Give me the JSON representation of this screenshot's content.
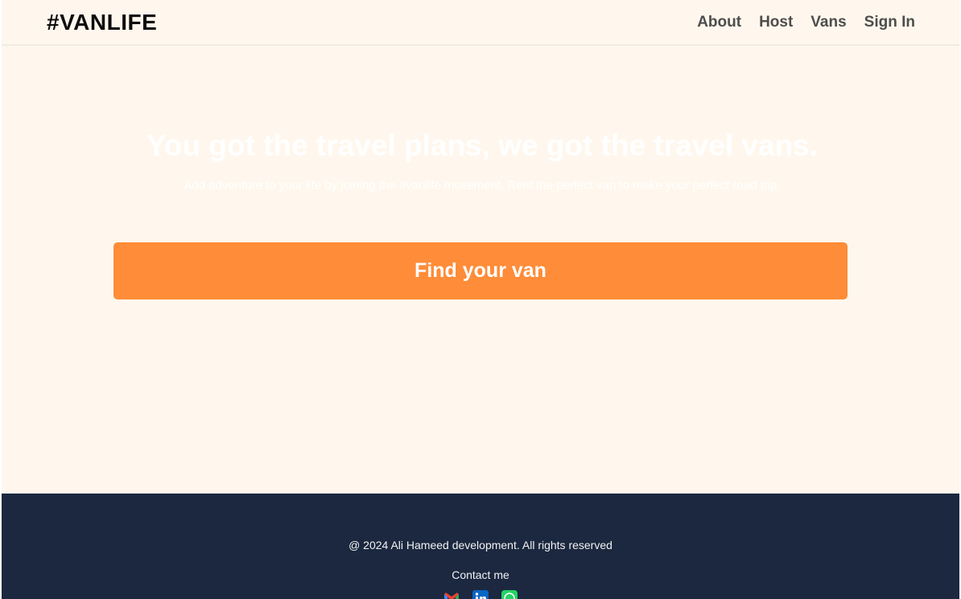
{
  "header": {
    "logo": "#VANLIFE",
    "nav": [
      {
        "label": "About"
      },
      {
        "label": "Host"
      },
      {
        "label": "Vans"
      },
      {
        "label": "Sign In"
      }
    ]
  },
  "hero": {
    "title": "You got the travel plans, we got the travel vans.",
    "subtitle": "Add adventure to your life by joining the #vanlife movement. Rent the perfect van to make your perfect road trip.",
    "cta_label": "Find your van"
  },
  "footer": {
    "copyright": "@ 2024 Ali Hameed development. All rights reserved",
    "contact_label": "Contact me",
    "socials": [
      {
        "icon": "gmail-icon",
        "color": "#d93025"
      },
      {
        "icon": "linkedin-icon",
        "color": "#0a66c2"
      },
      {
        "icon": "whatsapp-icon",
        "color": "#25d366"
      }
    ]
  },
  "colors": {
    "page_bg": "#fff7ed",
    "accent": "#ff8c38",
    "footer_bg": "#1b2840"
  }
}
